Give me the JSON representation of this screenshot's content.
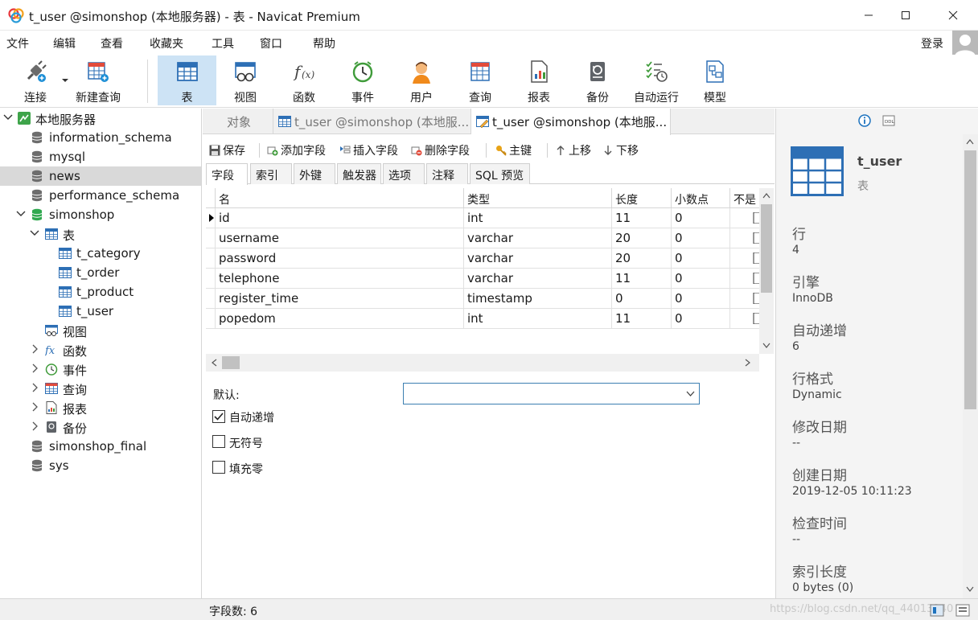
{
  "window": {
    "title": "t_user @simonshop (本地服务器) - 表 - Navicat Premium"
  },
  "menu": {
    "items": [
      "文件",
      "编辑",
      "查看",
      "收藏夹",
      "工具",
      "窗口",
      "帮助"
    ],
    "login": "登录"
  },
  "toolbar": {
    "buttons": [
      {
        "label": "连接",
        "icon": "connect-plug-icon"
      },
      {
        "label": "新建查询",
        "icon": "new-query-icon"
      },
      {
        "label": "表",
        "icon": "table-icon"
      },
      {
        "label": "视图",
        "icon": "view-icon"
      },
      {
        "label": "函数",
        "icon": "function-icon"
      },
      {
        "label": "事件",
        "icon": "event-clock-icon"
      },
      {
        "label": "用户",
        "icon": "user-icon"
      },
      {
        "label": "查询",
        "icon": "query-icon"
      },
      {
        "label": "报表",
        "icon": "report-icon"
      },
      {
        "label": "备份",
        "icon": "backup-icon"
      },
      {
        "label": "自动运行",
        "icon": "automation-icon"
      },
      {
        "label": "模型",
        "icon": "model-icon"
      }
    ],
    "active": "表"
  },
  "nav": {
    "root": "本地服务器",
    "databases": [
      "information_schema",
      "mysql",
      "news",
      "performance_schema",
      "simonshop"
    ],
    "selected": "news",
    "simonshop_children": {
      "tables_label": "表",
      "tables": [
        "t_category",
        "t_order",
        "t_product",
        "t_user"
      ]
    },
    "groups": [
      "视图",
      "函数",
      "事件",
      "查询",
      "报表",
      "备份"
    ],
    "more_databases": [
      "simonshop_final",
      "sys"
    ]
  },
  "tabs": {
    "objects": "对象",
    "tab1": "t_user @simonshop (本地服...",
    "tab2": "t_user @simonshop (本地服..."
  },
  "design_toolbar": {
    "save": "保存",
    "add_field": "添加字段",
    "insert_field": "插入字段",
    "delete_field": "删除字段",
    "primary_key": "主键",
    "move_up": "上移",
    "move_down": "下移"
  },
  "subtabs": [
    "字段",
    "索引",
    "外键",
    "触发器",
    "选项",
    "注释",
    "SQL 预览"
  ],
  "grid": {
    "columns": [
      "名",
      "类型",
      "长度",
      "小数点",
      "不是"
    ],
    "rows": [
      {
        "name": "id",
        "type": "int",
        "length": "11",
        "decimals": "0"
      },
      {
        "name": "username",
        "type": "varchar",
        "length": "20",
        "decimals": "0"
      },
      {
        "name": "password",
        "type": "varchar",
        "length": "20",
        "decimals": "0"
      },
      {
        "name": "telephone",
        "type": "varchar",
        "length": "11",
        "decimals": "0"
      },
      {
        "name": "register_time",
        "type": "timestamp",
        "length": "0",
        "decimals": "0"
      },
      {
        "name": "popedom",
        "type": "int",
        "length": "11",
        "decimals": "0"
      }
    ]
  },
  "props": {
    "default_label": "默认:",
    "auto_increment": {
      "label": "自动递增",
      "checked": true
    },
    "unsigned": {
      "label": "无符号",
      "checked": false
    },
    "zerofill": {
      "label": "填充零",
      "checked": false
    }
  },
  "info": {
    "name": "t_user",
    "kind": "表",
    "fields": [
      {
        "key": "行",
        "value": "4"
      },
      {
        "key": "引擎",
        "value": "InnoDB"
      },
      {
        "key": "自动递增",
        "value": "6"
      },
      {
        "key": "行格式",
        "value": "Dynamic"
      },
      {
        "key": "修改日期",
        "value": "--"
      },
      {
        "key": "创建日期",
        "value": "2019-12-05 10:11:23"
      },
      {
        "key": "检查时间",
        "value": "--"
      },
      {
        "key": "索引长度",
        "value": "0 bytes (0)"
      }
    ]
  },
  "status": {
    "field_count": "字段数: 6",
    "watermark": "https://blog.csdn.net/qq_44013240"
  },
  "colors": {
    "accent": "#1e73be",
    "toolbar_active": "#cde3f5",
    "db_green": "#2fa84f"
  }
}
